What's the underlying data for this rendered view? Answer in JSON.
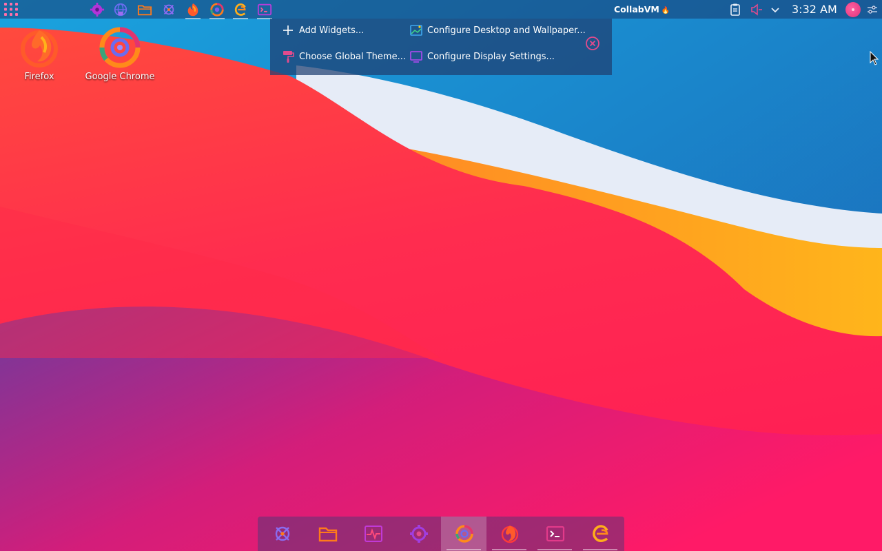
{
  "panel": {
    "launcher_icon": "app-grid-icon",
    "tasks": [
      {
        "icon": "settings-gear-icon"
      },
      {
        "icon": "network-globe-icon"
      },
      {
        "icon": "folder-icon"
      },
      {
        "icon": "bug-crossed-icon"
      },
      {
        "icon": "firefox-icon"
      },
      {
        "icon": "chrome-icon"
      },
      {
        "icon": "edge-icon"
      },
      {
        "icon": "terminal-icon"
      }
    ],
    "title": "CollabVM",
    "title_icon": "🔥",
    "tray": [
      {
        "icon": "clipboard-icon"
      },
      {
        "icon": "volume-muted-icon"
      },
      {
        "icon": "chevron-down-icon"
      }
    ],
    "clock": "3:32 AM",
    "menu_icon": "sliders-icon"
  },
  "desktop": {
    "icons": [
      {
        "label": "Firefox",
        "icon": "firefox-icon"
      },
      {
        "label": "Google Chrome",
        "icon": "chrome-icon"
      }
    ]
  },
  "toolbox": {
    "items": [
      {
        "label": "Add Widgets...",
        "icon": "plus-icon"
      },
      {
        "label": "Configure Desktop and Wallpaper...",
        "icon": "wallpaper-icon"
      },
      {
        "label": "Choose Global Theme...",
        "icon": "paint-roller-icon"
      },
      {
        "label": "Configure Display Settings...",
        "icon": "display-icon"
      }
    ],
    "close_icon": "close-circle-icon"
  },
  "dock": {
    "items": [
      {
        "icon": "bug-crossed-icon"
      },
      {
        "icon": "folder-icon"
      },
      {
        "icon": "activity-monitor-icon"
      },
      {
        "icon": "settings-gear-icon"
      },
      {
        "icon": "chrome-icon",
        "active": true
      },
      {
        "icon": "firefox-icon"
      },
      {
        "icon": "terminal-icon"
      },
      {
        "icon": "edge-icon"
      }
    ]
  },
  "colors": {
    "accent": "#e24b8d",
    "orange": "#ff7a1a",
    "purple": "#8a3ee0",
    "panel": "#1b3b73"
  }
}
